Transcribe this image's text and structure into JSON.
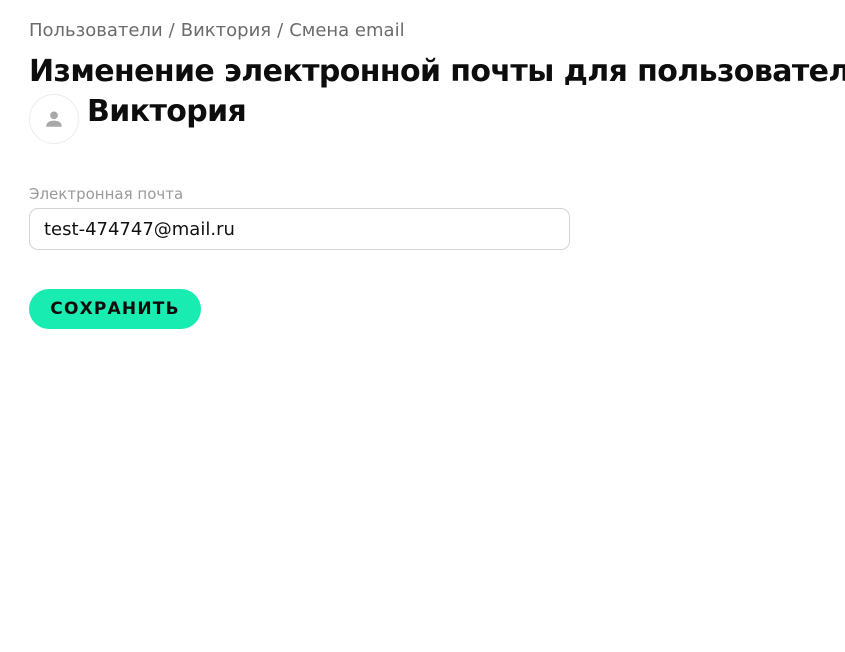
{
  "breadcrumb": {
    "items": [
      "Пользователи",
      "Виктория",
      "Смена email"
    ],
    "separator": "/"
  },
  "page": {
    "title_main": "Изменение электронной почты для пользователя",
    "user_name": "Виктория",
    "avatar_icon": "user-icon"
  },
  "form": {
    "email_label": "Электронная почта",
    "email_value": "test-474747@mail.ru",
    "save_label": "СОХРАНИТЬ"
  },
  "colors": {
    "accent": "#18ecb0",
    "breadcrumb_text": "#6b6b6b",
    "label_text": "#9a9a9a",
    "input_border": "#d4d4d4",
    "avatar_icon": "#a8a8a8"
  }
}
